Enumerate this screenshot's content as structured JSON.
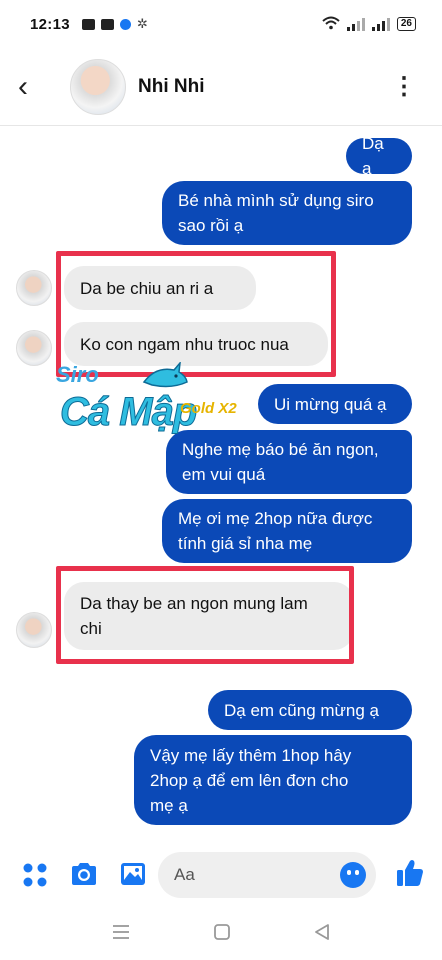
{
  "status_bar": {
    "time": "12:13",
    "battery": "26"
  },
  "header": {
    "contact_name": "Nhi Nhi"
  },
  "messages": [
    {
      "dir": "out",
      "lines": [
        "Dạ ạ"
      ]
    },
    {
      "dir": "out",
      "lines": [
        "Bé nhà mình sử dụng siro",
        "sao rồi ạ"
      ]
    },
    {
      "dir": "in",
      "lines": [
        "Da be chiu an ri a"
      ]
    },
    {
      "dir": "in",
      "lines": [
        "Ko con ngam nhu truoc nua"
      ]
    },
    {
      "dir": "out",
      "lines": [
        "Ui mừng quá ạ"
      ]
    },
    {
      "dir": "out",
      "lines": [
        "Nghe mẹ báo bé ăn ngon,",
        "em vui quá"
      ]
    },
    {
      "dir": "out",
      "lines": [
        "Mẹ ơi mẹ 2hop nữa được",
        "tính giá sỉ nha mẹ"
      ]
    },
    {
      "dir": "in",
      "lines": [
        "Da thay be an ngon mung lam",
        "chi"
      ]
    },
    {
      "dir": "out",
      "lines": [
        "Dạ em cũng mừng ạ"
      ]
    },
    {
      "dir": "out",
      "lines": [
        "Vậy mẹ lấy thêm 1hop hây",
        "2hop ạ để em lên đơn cho",
        "mẹ ạ"
      ]
    }
  ],
  "logo": {
    "siro": "Siro",
    "brand": "Cá Mập",
    "gold": "Gold X2"
  },
  "composer": {
    "placeholder": "Aa"
  },
  "icons": {
    "menu": "four-dots-icon",
    "camera": "camera-icon",
    "gallery": "image-icon",
    "emoji": "smiley-icon",
    "like": "thumbs-up-icon"
  },
  "colors": {
    "outgoing_bubble": "#0b49b7",
    "incoming_bubble": "#ececec",
    "highlight_box": "#e8314c",
    "messenger_blue": "#1877f2"
  }
}
